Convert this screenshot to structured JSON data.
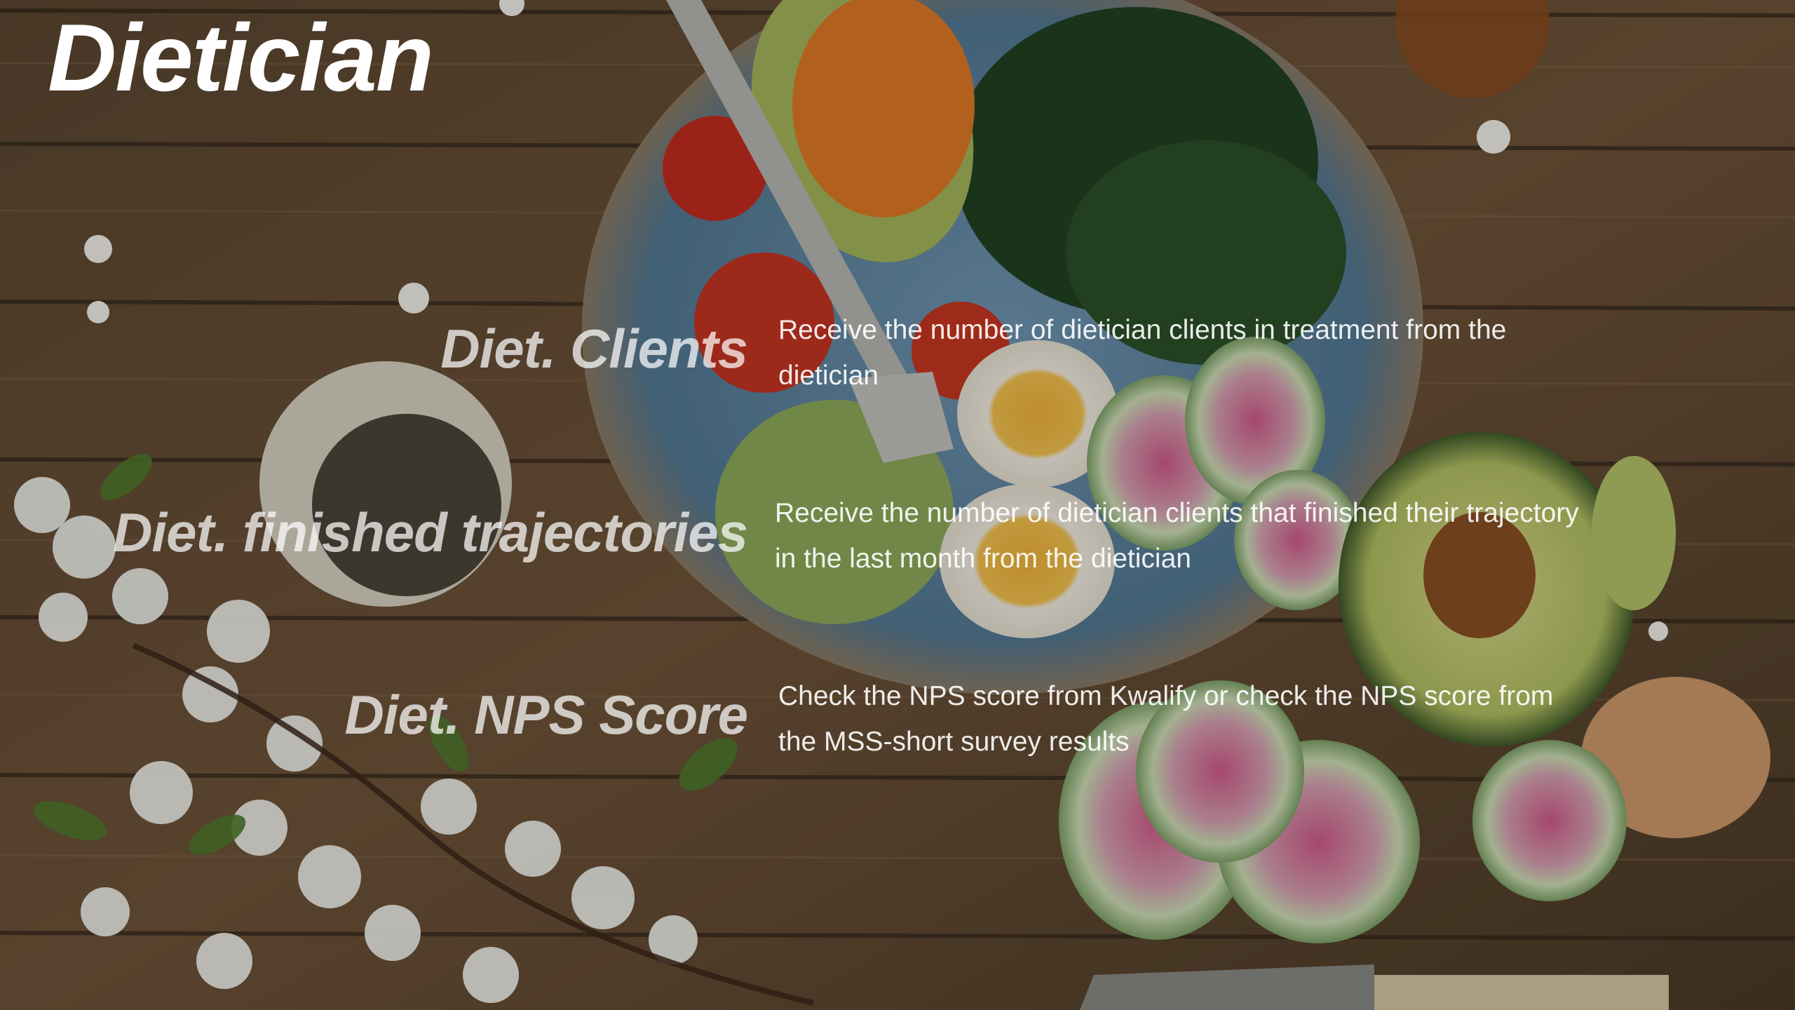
{
  "slide": {
    "title": "Dietician",
    "metrics": [
      {
        "name": "Diet. Clients",
        "description": "Receive the number of dietician clients in treatment from the dietician"
      },
      {
        "name": "Diet. finished trajectories",
        "description": "Receive the number of dietician clients that finished their trajectory in the last month from the dietician"
      },
      {
        "name": "Diet. NPS Score",
        "description": "Check the NPS score from Kwalify or check the NPS score from the MSS-short survey results"
      }
    ]
  },
  "colors": {
    "text": "#ffffff",
    "wood": "#6b5238",
    "plate": "#5f88a8",
    "avocado": "#b9c46a",
    "radish": "#c24a7a"
  }
}
